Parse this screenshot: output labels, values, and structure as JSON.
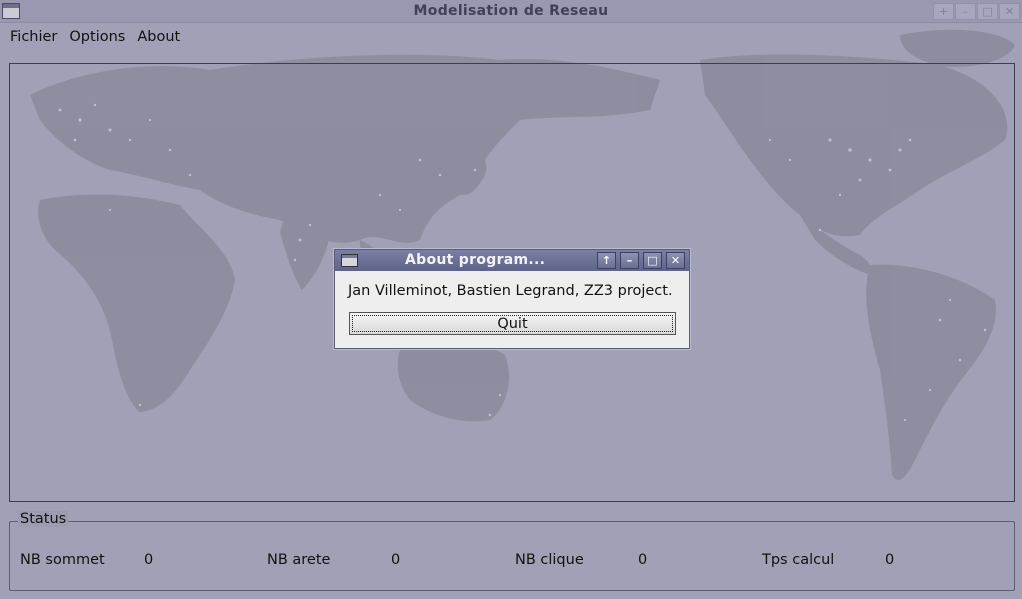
{
  "window": {
    "title": "Modelisation de Reseau",
    "controls": [
      "+",
      "–",
      "□",
      "✕"
    ]
  },
  "menubar": {
    "items": [
      "Fichier",
      "Options",
      "About"
    ]
  },
  "status": {
    "legend": "Status",
    "fields": [
      {
        "label": "NB sommet",
        "value": "0"
      },
      {
        "label": "NB arete",
        "value": "0"
      },
      {
        "label": "NB clique",
        "value": "0"
      },
      {
        "label": "Tps calcul",
        "value": "0"
      }
    ]
  },
  "dialog": {
    "title": "About program...",
    "message": "Jan Villeminot, Bastien Legrand, ZZ3 project.",
    "quit_label": "Quit",
    "controls": [
      "↑",
      "–",
      "□",
      "✕"
    ]
  },
  "colors": {
    "window_bg": "#9a9cb0",
    "map_ocean": "#9b9db2",
    "map_land": "#7c7e8f",
    "city_lights": "#f2efd2",
    "dialog_title_bar": "#6b6f94",
    "dialog_bg": "#eeeeee"
  }
}
